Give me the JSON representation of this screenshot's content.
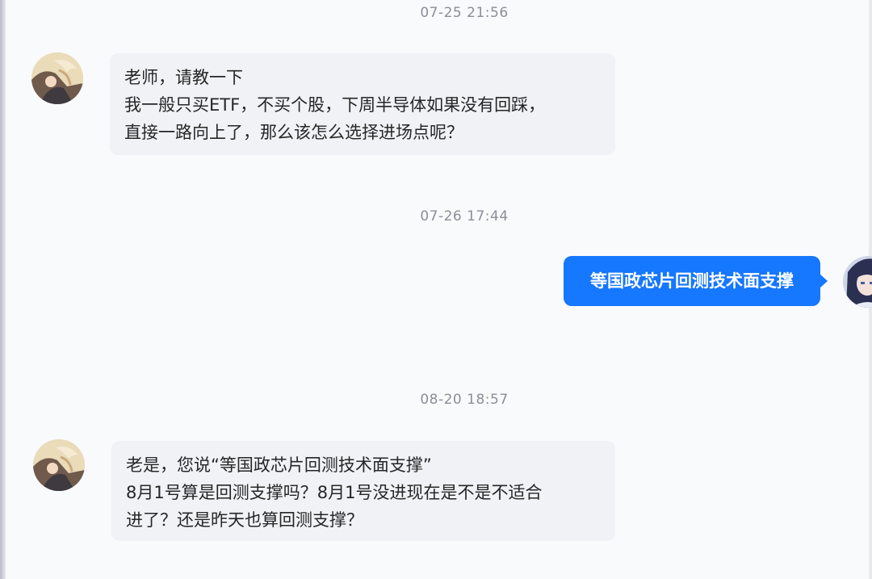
{
  "colors": {
    "background": "#f9fafb",
    "incoming_bubble": "#f0f2f5",
    "outgoing_bubble": "#1677ff",
    "timestamp_text": "#8a8f98"
  },
  "messages": [
    {
      "timestamp": "07-25 21:56",
      "direction": "incoming",
      "avatar_icon": "anime-character-avatar-icon",
      "lines": [
        "老师，请教一下",
        "我一般只买ETF，不买个股，下周半导体如果没有回踩，",
        "直接一路向上了，那么该怎么选择进场点呢？"
      ]
    },
    {
      "timestamp": "07-26 17:44",
      "direction": "outgoing",
      "avatar_icon": "anime-girl-avatar-icon",
      "text": "等国政芯片回测技术面支撑"
    },
    {
      "timestamp": "08-20 18:57",
      "direction": "incoming",
      "avatar_icon": "anime-character-avatar-icon",
      "lines": [
        "老是，您说“等国政芯片回测技术面支撑”",
        "8月1号算是回测支撑吗？8月1号没进现在是不是不适合",
        "进了？还是昨天也算回测支撑？"
      ]
    }
  ]
}
